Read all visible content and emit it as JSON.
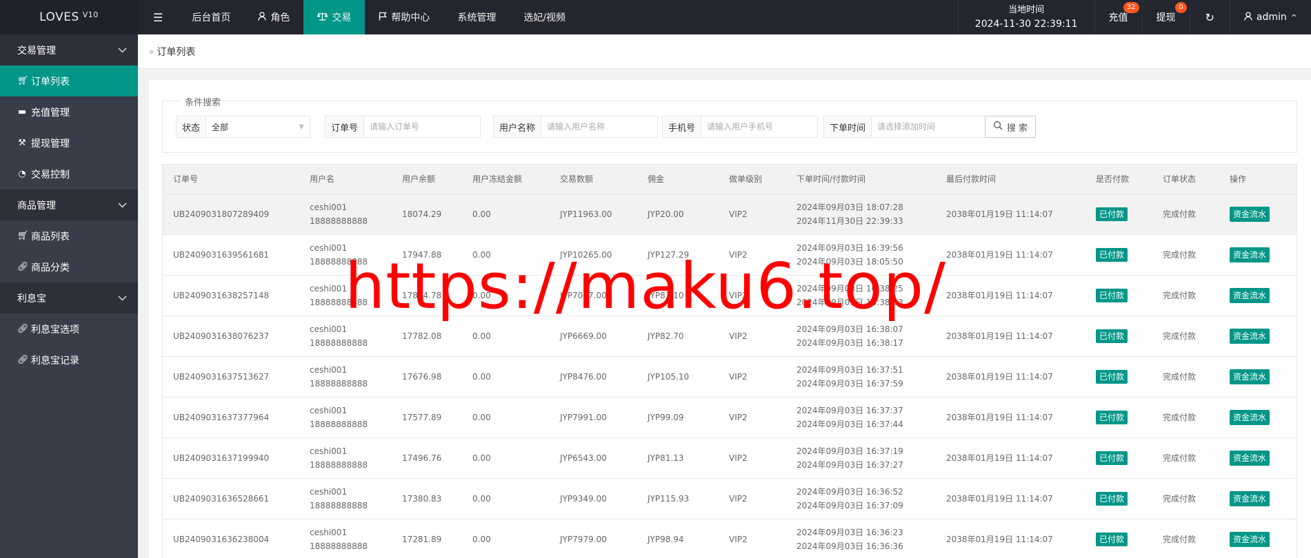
{
  "header": {
    "logo": "LOVES",
    "logo_version": "V10",
    "nav": [
      {
        "label": "后台首页",
        "icon": ""
      },
      {
        "label": "角色",
        "icon": "user-icon"
      },
      {
        "label": "交易",
        "icon": "scale-icon"
      },
      {
        "label": "帮助中心",
        "icon": "flag-icon"
      },
      {
        "label": "系统管理",
        "icon": ""
      },
      {
        "label": "选妃/视频",
        "icon": ""
      }
    ],
    "time_label": "当地时间",
    "time_value": "2024-11-30 22:39:11",
    "recharge_label": "充值",
    "recharge_badge": "32",
    "withdraw_label": "提现",
    "withdraw_badge": "0",
    "user": "admin"
  },
  "sidebar": {
    "groups": [
      {
        "label": "交易管理",
        "items": [
          {
            "label": "订单列表",
            "icon": "cart-icon"
          },
          {
            "label": "充值管理",
            "icon": "card-icon"
          },
          {
            "label": "提现管理",
            "icon": "gavel-icon"
          },
          {
            "label": "交易控制",
            "icon": "dashboard-icon"
          }
        ]
      },
      {
        "label": "商品管理",
        "items": [
          {
            "label": "商品列表",
            "icon": "cart-icon"
          },
          {
            "label": "商品分类",
            "icon": "link-icon"
          }
        ]
      },
      {
        "label": "利息宝",
        "items": [
          {
            "label": "利息宝选项",
            "icon": "link-icon"
          },
          {
            "label": "利息宝记录",
            "icon": "link-icon"
          }
        ]
      }
    ]
  },
  "breadcrumb": "订单列表",
  "search": {
    "legend": "条件搜索",
    "status_label": "状态",
    "status_value": "全部",
    "order_label": "订单号",
    "order_placeholder": "请输入订单号",
    "username_label": "用户名称",
    "username_placeholder": "请输入用户名称",
    "phone_label": "手机号",
    "phone_placeholder": "请输入用户手机号",
    "time_label": "下单时间",
    "time_placeholder": "请选择添加时间",
    "button": "搜 索"
  },
  "table": {
    "columns": [
      "订单号",
      "用户名",
      "用户余额",
      "用户冻结金额",
      "交易数额",
      "佣金",
      "做单级别",
      "下单时间/付款时间",
      "最后付款时间",
      "是否付款",
      "订单状态",
      "操作"
    ],
    "rows": [
      {
        "order": "UB2409031807289409",
        "user": "ceshi001",
        "phone": "18888888888",
        "balance": "18074.29",
        "frozen": "0.00",
        "amount": "JYP11963.00",
        "commission": "JYP20.00",
        "level": "VIP2",
        "time1": "2024年09月03日 18:07:28",
        "time2": "2024年11月30日 22:39:33",
        "last": "2038年01月19日 11:14:07",
        "paid": "已付款",
        "status": "完成付款",
        "action": "资金流水"
      },
      {
        "order": "UB2409031639561681",
        "user": "ceshi001",
        "phone": "18888888888",
        "balance": "17947.88",
        "frozen": "0.00",
        "amount": "JYP10265.00",
        "commission": "JYP127.29",
        "level": "VIP2",
        "time1": "2024年09月03日 16:39:56",
        "time2": "2024年09月03日 18:05:50",
        "last": "2038年01月19日 11:14:07",
        "paid": "已付款",
        "status": "完成付款",
        "action": "资金流水"
      },
      {
        "order": "UB2409031638257148",
        "user": "ceshi001",
        "phone": "18888888888",
        "balance": "17864.78",
        "frozen": "0.00",
        "amount": "JYP7027.00",
        "commission": "JYP83.10",
        "level": "VIP2",
        "time1": "2024年09月03日 16:38:25",
        "time2": "2024年09月03日 16:38:33",
        "last": "2038年01月19日 11:14:07",
        "paid": "已付款",
        "status": "完成付款",
        "action": "资金流水"
      },
      {
        "order": "UB2409031638076237",
        "user": "ceshi001",
        "phone": "18888888888",
        "balance": "17782.08",
        "frozen": "0.00",
        "amount": "JYP6669.00",
        "commission": "JYP82.70",
        "level": "VIP2",
        "time1": "2024年09月03日 16:38:07",
        "time2": "2024年09月03日 16:38:17",
        "last": "2038年01月19日 11:14:07",
        "paid": "已付款",
        "status": "完成付款",
        "action": "资金流水"
      },
      {
        "order": "UB2409031637513627",
        "user": "ceshi001",
        "phone": "18888888888",
        "balance": "17676.98",
        "frozen": "0.00",
        "amount": "JYP8476.00",
        "commission": "JYP105.10",
        "level": "VIP2",
        "time1": "2024年09月03日 16:37:51",
        "time2": "2024年09月03日 16:37:59",
        "last": "2038年01月19日 11:14:07",
        "paid": "已付款",
        "status": "完成付款",
        "action": "资金流水"
      },
      {
        "order": "UB2409031637377964",
        "user": "ceshi001",
        "phone": "18888888888",
        "balance": "17577.89",
        "frozen": "0.00",
        "amount": "JYP7991.00",
        "commission": "JYP99.09",
        "level": "VIP2",
        "time1": "2024年09月03日 16:37:37",
        "time2": "2024年09月03日 16:37:44",
        "last": "2038年01月19日 11:14:07",
        "paid": "已付款",
        "status": "完成付款",
        "action": "资金流水"
      },
      {
        "order": "UB2409031637199940",
        "user": "ceshi001",
        "phone": "18888888888",
        "balance": "17496.76",
        "frozen": "0.00",
        "amount": "JYP6543.00",
        "commission": "JYP81.13",
        "level": "VIP2",
        "time1": "2024年09月03日 16:37:19",
        "time2": "2024年09月03日 16:37:27",
        "last": "2038年01月19日 11:14:07",
        "paid": "已付款",
        "status": "完成付款",
        "action": "资金流水"
      },
      {
        "order": "UB2409031636528661",
        "user": "ceshi001",
        "phone": "18888888888",
        "balance": "17380.83",
        "frozen": "0.00",
        "amount": "JYP9349.00",
        "commission": "JYP115.93",
        "level": "VIP2",
        "time1": "2024年09月03日 16:36:52",
        "time2": "2024年09月03日 16:37:09",
        "last": "2038年01月19日 11:14:07",
        "paid": "已付款",
        "status": "完成付款",
        "action": "资金流水"
      },
      {
        "order": "UB2409031636238004",
        "user": "ceshi001",
        "phone": "18888888888",
        "balance": "17281.89",
        "frozen": "0.00",
        "amount": "JYP7979.00",
        "commission": "JYP98.94",
        "level": "VIP2",
        "time1": "2024年09月03日 16:36:23",
        "time2": "2024年09月03日 16:36:36",
        "last": "2038年01月19日 11:14:07",
        "paid": "已付款",
        "status": "完成付款",
        "action": "资金流水"
      }
    ]
  },
  "watermark": "https://maku6.top/",
  "colors": {
    "accent": "#009688",
    "header_bg": "#23262e",
    "sidebar_bg": "#393d49",
    "badge": "#ff5722",
    "watermark": "#ff0000"
  }
}
